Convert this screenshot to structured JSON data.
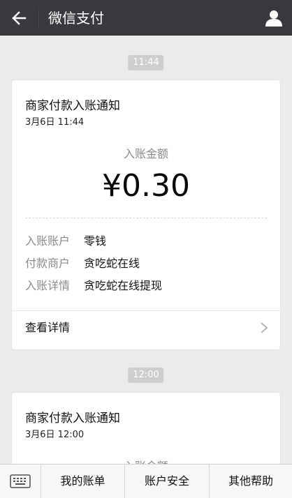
{
  "header": {
    "title": "微信支付",
    "back_icon": "arrow-left-icon",
    "user_icon": "user-icon"
  },
  "messages": [
    {
      "time": "11:44",
      "title": "商家付款入账通知",
      "date": "3月6日  11:44",
      "amount_label": "入账金额",
      "amount": "¥0.30",
      "rows": [
        {
          "key": "入账账户",
          "value": "零钱"
        },
        {
          "key": "付款商户",
          "value": "贪吃蛇在线"
        },
        {
          "key": "入账详情",
          "value": "贪吃蛇在线提现"
        }
      ],
      "detail_link": "查看详情"
    },
    {
      "time": "12:00",
      "title": "商家付款入账通知",
      "date": "3月6日  12:00",
      "amount_label": "入账金额"
    }
  ],
  "bottom_menu": {
    "keyboard_icon": "keyboard-icon",
    "items": [
      "我的账单",
      "账户安全",
      "其他帮助"
    ]
  }
}
